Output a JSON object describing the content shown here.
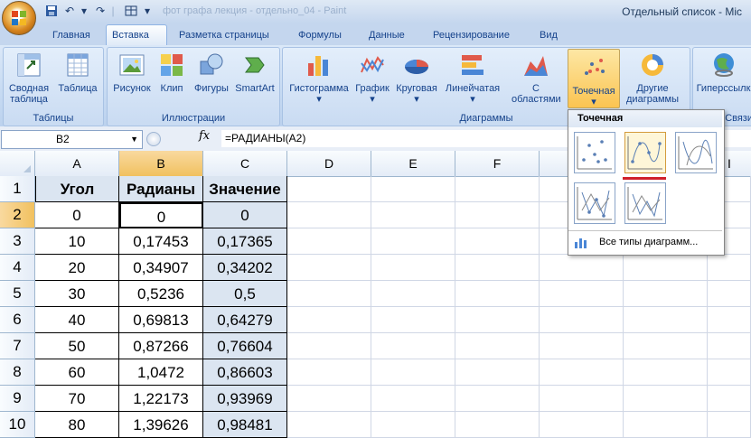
{
  "window": {
    "title_right": "Отдельный список - Mic",
    "doc_title_faded": "фот графа лекция - отдельно_04 - Paint"
  },
  "quick_access": [
    "save-icon",
    "undo-icon",
    "redo-icon",
    "table-icon",
    "customize-icon"
  ],
  "tabs": [
    "Главная",
    "Вставка",
    "Разметка страницы",
    "Формулы",
    "Данные",
    "Рецензирование",
    "Вид"
  ],
  "active_tab": "Вставка",
  "ribbon": {
    "groups": {
      "tables": "Таблицы",
      "illustrations": "Иллюстрации",
      "charts": "Диаграммы",
      "links": "Связи"
    },
    "buttons": {
      "pivot": "Сводная\nтаблица",
      "table": "Таблица",
      "picture": "Рисунок",
      "clip": "Клип",
      "shapes": "Фигуры",
      "smartart": "SmartArt",
      "histogram": "Гистограмма",
      "line": "График",
      "pie": "Круговая",
      "bar": "Линейчатая",
      "area": "С\nобластями",
      "scatter": "Точечная",
      "other": "Другие\nдиаграммы",
      "hyperlink": "Гиперссылк"
    }
  },
  "formula_bar": {
    "name_box": "B2",
    "fx": "fx",
    "formula": "=РАДИАНЫ(A2)"
  },
  "columns": [
    "A",
    "B",
    "C",
    "D",
    "E",
    "F",
    "G",
    "H",
    "I"
  ],
  "rows": [
    "1",
    "2",
    "3",
    "4",
    "5",
    "6",
    "7",
    "8",
    "9",
    "10"
  ],
  "table": {
    "headers": [
      "Угол",
      "Радианы",
      "Значение"
    ],
    "data": [
      [
        "0",
        "0",
        "0"
      ],
      [
        "10",
        "0,17453",
        "0,17365"
      ],
      [
        "20",
        "0,34907",
        "0,34202"
      ],
      [
        "30",
        "0,5236",
        "0,5"
      ],
      [
        "40",
        "0,69813",
        "0,64279"
      ],
      [
        "50",
        "0,87266",
        "0,76604"
      ],
      [
        "60",
        "1,0472",
        "0,86603"
      ],
      [
        "70",
        "1,22173",
        "0,93969"
      ],
      [
        "80",
        "1,39626",
        "0,98481"
      ]
    ]
  },
  "dropdown": {
    "title": "Точечная",
    "footer": "Все типы диаграмм..."
  },
  "colors": {
    "accent": "#fbc451",
    "highlight_line": "#d0202a",
    "header_fill": "#dbe5f1"
  }
}
